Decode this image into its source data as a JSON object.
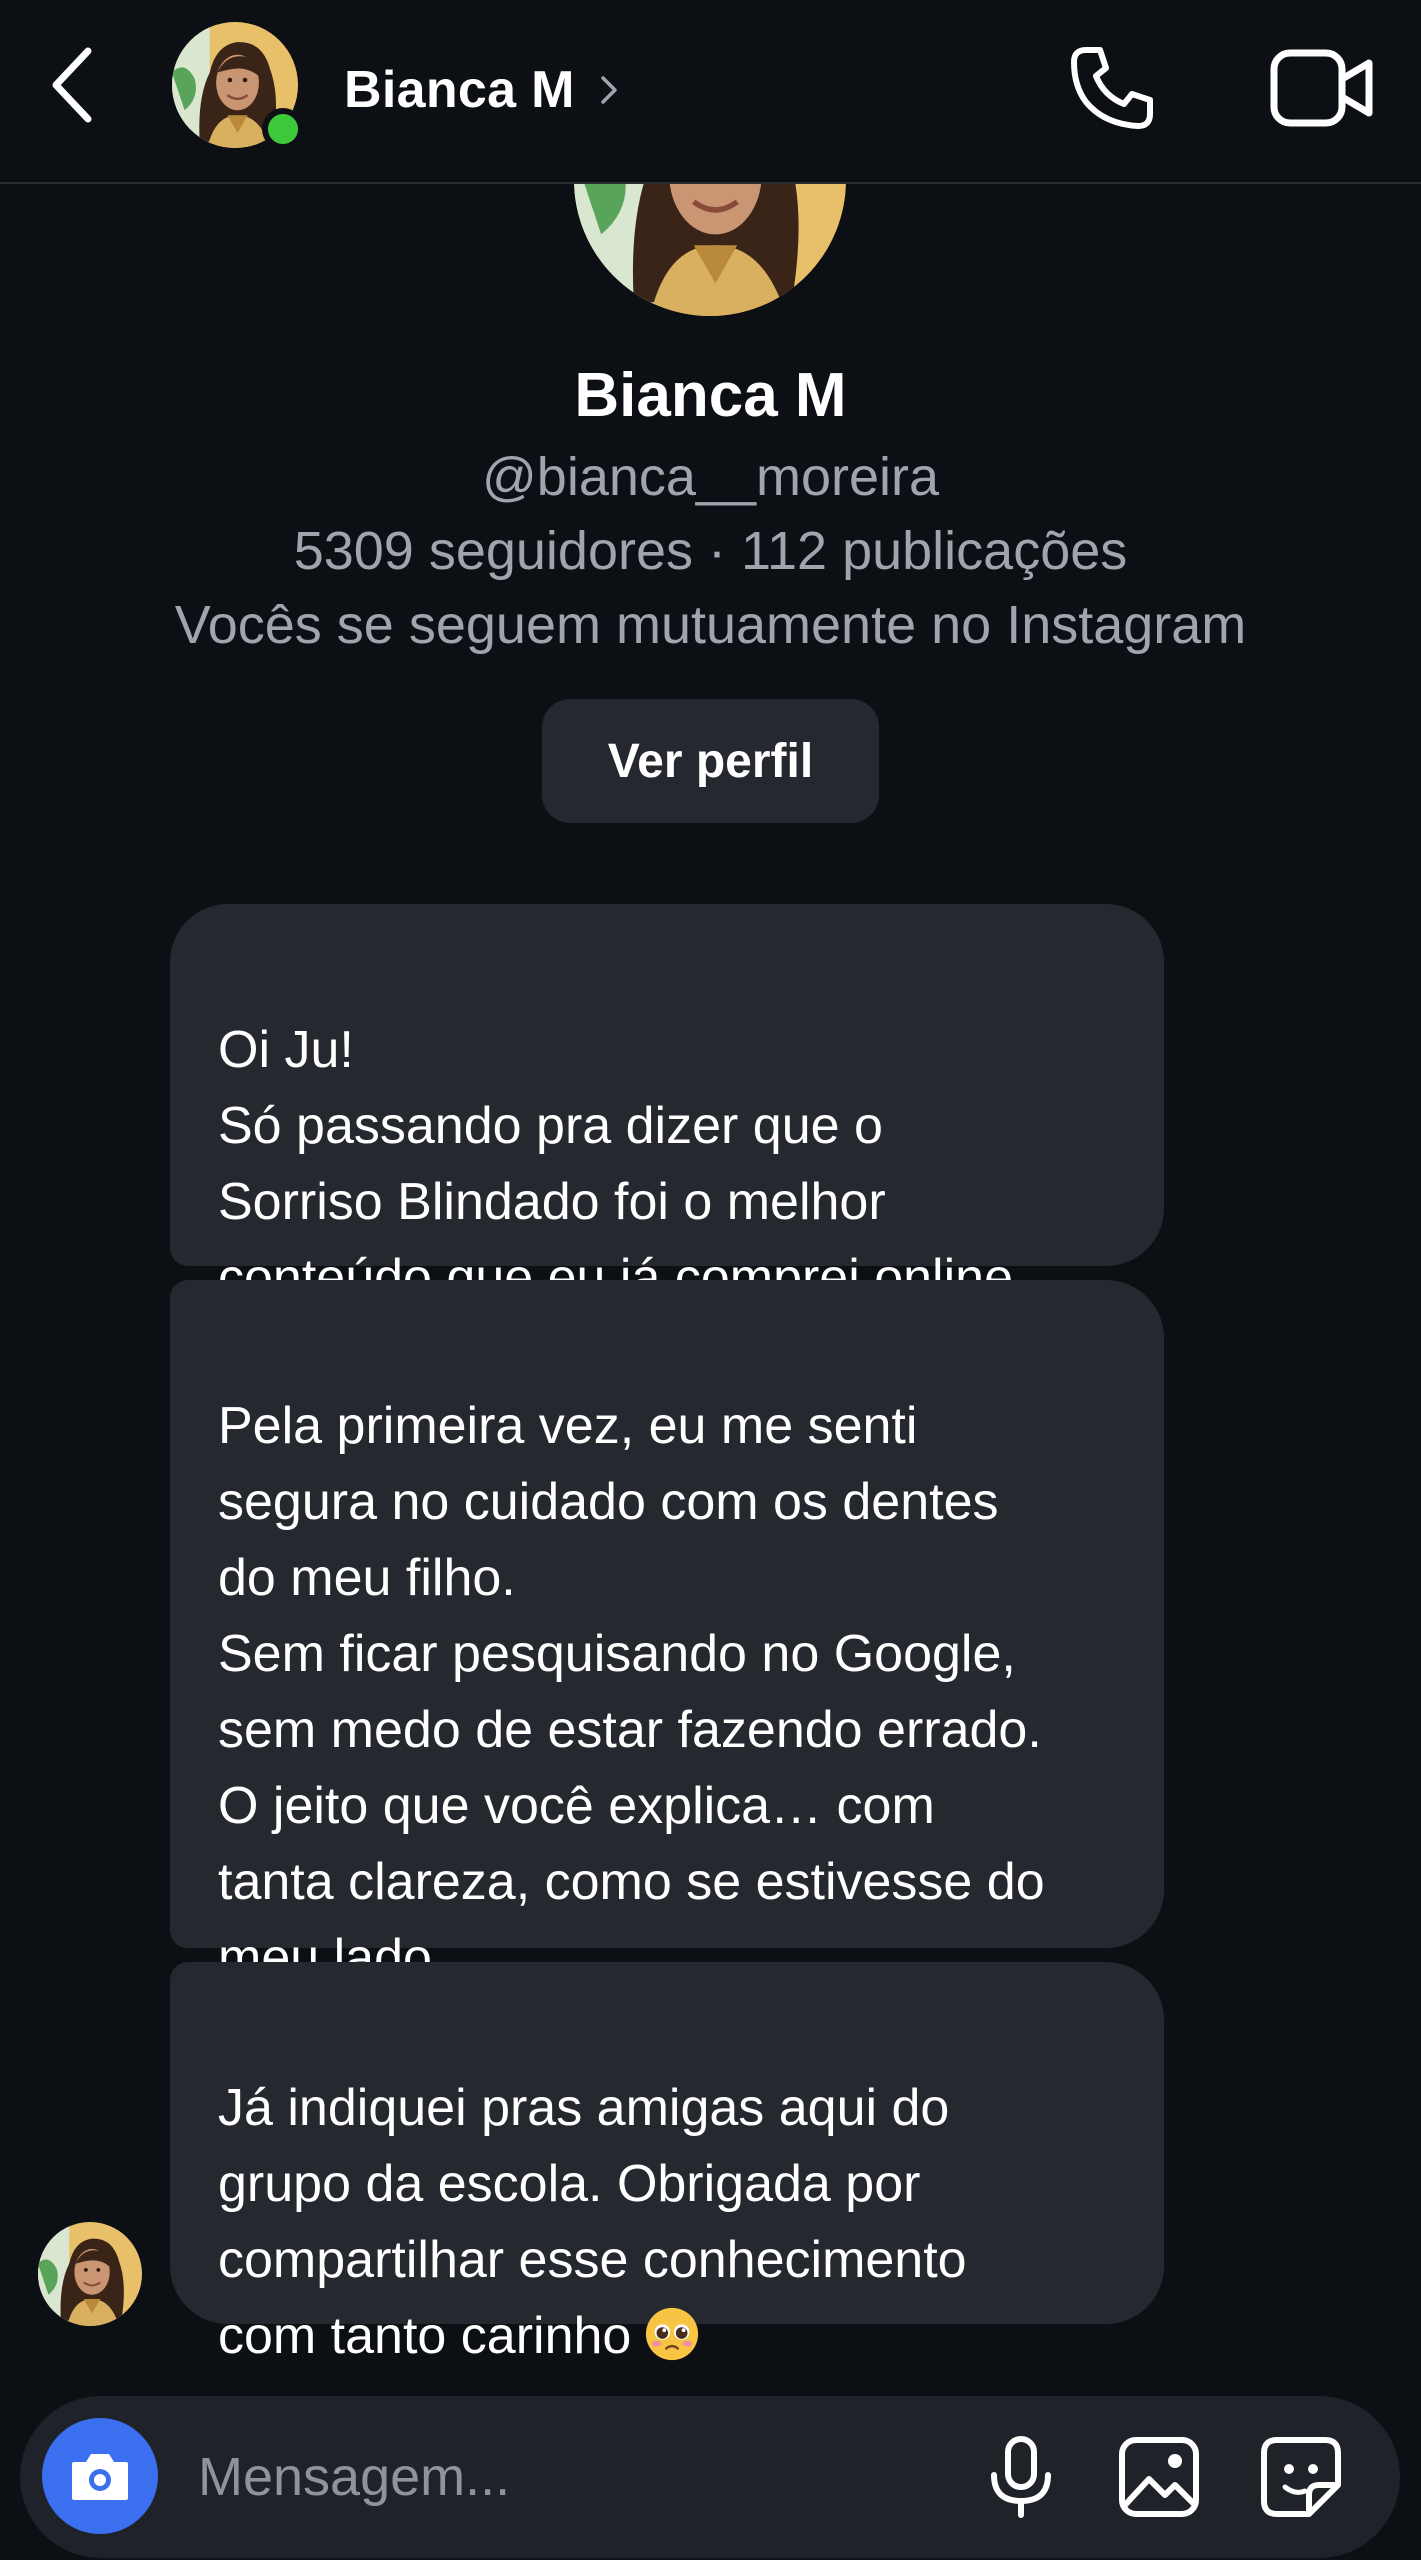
{
  "header": {
    "name": "Bianca M",
    "chevron": "›",
    "back_icon": "chevron-left-icon",
    "call_icon": "phone-icon",
    "video_icon": "video-camera-icon",
    "online": true,
    "online_color": "#3ec93a"
  },
  "profile": {
    "name": "Bianca M",
    "handle": "@bianca__moreira",
    "stats": "5309 seguidores · 112 publicações",
    "mutual": "Vocês se seguem mutuamente no Instagram",
    "view_profile_label": "Ver perfil"
  },
  "messages": [
    {
      "text": "Oi Ju!\nSó passando pra dizer que o\nSorriso Blindado foi o melhor\nconteúdo que eu já comprei online."
    },
    {
      "text": "Pela primeira vez, eu me senti\nsegura no cuidado com os dentes\ndo meu filho.\nSem ficar pesquisando no Google,\nsem medo de estar fazendo errado.\nO jeito que você explica… com\ntanta clareza, como se estivesse do\nmeu lado."
    },
    {
      "text": "Já indiquei pras amigas aqui do\ngrupo da escola. Obrigada por\ncompartilhar esse conhecimento\ncom tanto carinho",
      "emoji": "pleading-face-emoji"
    }
  ],
  "composer": {
    "placeholder": "Mensagem...",
    "camera_icon": "camera-icon",
    "mic_icon": "microphone-icon",
    "gallery_icon": "gallery-icon",
    "sticker_icon": "sticker-icon",
    "accent_color": "#3a6ff0"
  },
  "colors": {
    "background": "#0c0f14",
    "bubble": "#25282e",
    "secondary_text": "#9fa4ad"
  }
}
